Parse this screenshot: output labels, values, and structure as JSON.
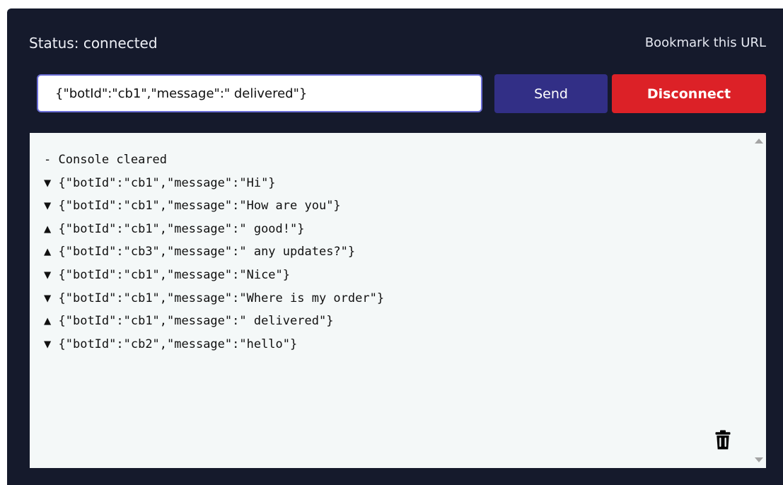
{
  "header": {
    "status": "Status: connected",
    "bookmark": "Bookmark this URL"
  },
  "controls": {
    "input_value": "{\"botId\":\"cb1\",\"message\":\" delivered\"}",
    "send_label": "Send",
    "disconnect_label": "Disconnect"
  },
  "console": {
    "lines": [
      {
        "marker": "-",
        "text": "Console cleared"
      },
      {
        "marker": "▼",
        "text": "{\"botId\":\"cb1\",\"message\":\"Hi\"}"
      },
      {
        "marker": "▼",
        "text": "{\"botId\":\"cb1\",\"message\":\"How are you\"}"
      },
      {
        "marker": "▲",
        "text": "{\"botId\":\"cb1\",\"message\":\" good!\"}"
      },
      {
        "marker": "▲",
        "text": "{\"botId\":\"cb3\",\"message\":\" any updates?\"}"
      },
      {
        "marker": "▼",
        "text": "{\"botId\":\"cb1\",\"message\":\"Nice\"}"
      },
      {
        "marker": "▼",
        "text": "{\"botId\":\"cb1\",\"message\":\"Where is my order\"}"
      },
      {
        "marker": "▲",
        "text": "{\"botId\":\"cb1\",\"message\":\" delivered\"}"
      },
      {
        "marker": "▼",
        "text": "{\"botId\":\"cb2\",\"message\":\"hello\"}"
      }
    ],
    "clear_icon": "trash-icon"
  },
  "colors": {
    "panel_bg": "#151a2c",
    "send_bg": "#322f86",
    "disconnect_bg": "#dc2127",
    "console_bg": "#f4f8f8"
  }
}
